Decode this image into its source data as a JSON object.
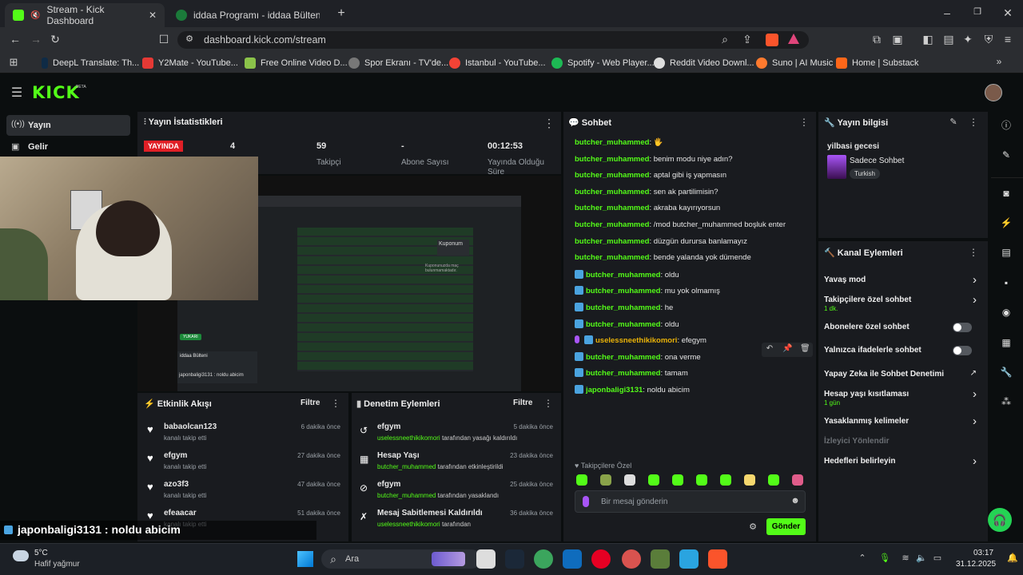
{
  "browser": {
    "tabs": [
      {
        "title": "Stream - Kick Dashboard",
        "active": true
      },
      {
        "title": "iddaa Programı - iddaa Bülteni | iddaa"
      }
    ],
    "url": "dashboard.kick.com/stream",
    "bookmarks": [
      "DeepL Translate: Th...",
      "Y2Mate - YouTube...",
      "Free Online Video D...",
      "Spor Ekranı - TV'de...",
      "Istanbul - YouTube...",
      "Spotify - Web Player...",
      "Reddit Video Downl...",
      "Suno | AI Music",
      "Home | Substack"
    ]
  },
  "kick": {
    "logo": "KICK",
    "logo_beta": "BETA",
    "nav": [
      {
        "label": "Yayın",
        "active": true
      },
      {
        "label": "Gelir"
      }
    ]
  },
  "stats": {
    "title": "Yayın İstatistikleri",
    "live_badge": "YAYINDA",
    "items": [
      {
        "value": "4",
        "label": ""
      },
      {
        "value": "59",
        "label": "Takipçi"
      },
      {
        "value": "-",
        "label": "Abone Sayısı"
      },
      {
        "value": "00:12:53",
        "label": "Yayında Olduğu Süre"
      }
    ]
  },
  "preview": {
    "overlay_left": "YUKARI",
    "overlay_chat": "japonbaligi3131 : noldu abicim",
    "coupon_title": "Kuponum",
    "coupon_empty": "Kuponunuzda maç bulunmamaktadır.",
    "bulletin": "iddaa Bülteni"
  },
  "activity": {
    "title": "Etkinlik Akışı",
    "filter": "Filtre",
    "items": [
      {
        "user": "babaolcan123",
        "action": "kanalı takip etti",
        "time": "6 dakika önce"
      },
      {
        "user": "efgym",
        "action": "kanalı takip etti",
        "time": "27 dakika önce"
      },
      {
        "user": "azo3f3",
        "action": "kanalı takip etti",
        "time": "47 dakika önce"
      },
      {
        "user": "efeaacar",
        "action": "kanalı takip etti",
        "time": "51 dakika önce"
      }
    ]
  },
  "moderation": {
    "title": "Denetim Eylemleri",
    "filter": "Filtre",
    "items": [
      {
        "title": "efgym",
        "actor": "uselessneethikikomori",
        "desc": "tarafından yasağı kaldırıldı",
        "time": "5 dakika önce",
        "icon": "undo-icon"
      },
      {
        "title": "Hesap Yaşı",
        "actor": "butcher_muhammed",
        "desc": "tarafından etkinleştirildi",
        "time": "23 dakika önce",
        "icon": "calendar-icon"
      },
      {
        "title": "efgym",
        "actor": "butcher_muhammed",
        "desc": "tarafından yasaklandı",
        "time": "25 dakika önce",
        "icon": "ban-icon"
      },
      {
        "title": "Mesaj Sabitlemesi Kaldırıldı",
        "actor": "uselessneethikikomori",
        "desc": "tarafından",
        "time": "36 dakika önce",
        "icon": "unpin-icon"
      }
    ]
  },
  "chat": {
    "title": "Sohbet",
    "messages": [
      {
        "user": "butcher_muhammed",
        "text": "🖐",
        "badge": false
      },
      {
        "user": "butcher_muhammed",
        "text": "benim modu niye adın?",
        "badge": false
      },
      {
        "user": "butcher_muhammed",
        "text": "aptal gibi iş yapmasın",
        "badge": false
      },
      {
        "user": "butcher_muhammed",
        "text": "sen ak partilimisin?",
        "badge": false
      },
      {
        "user": "butcher_muhammed",
        "text": "akraba kayırıyorsun",
        "badge": false
      },
      {
        "user": "butcher_muhammed",
        "text": "/mod butcher_muhammed boşluk enter",
        "badge": false
      },
      {
        "user": "butcher_muhammed",
        "text": "düzgün durursa banlamayız",
        "badge": false
      },
      {
        "user": "butcher_muhammed",
        "text": "bende yalanda yok dümende",
        "badge": false
      },
      {
        "user": "butcher_muhammed",
        "text": "oldu",
        "badge": true
      },
      {
        "user": "butcher_muhammed",
        "text": "mu yok olmamış",
        "badge": true
      },
      {
        "user": "butcher_muhammed",
        "text": "he",
        "badge": true
      },
      {
        "user": "butcher_muhammed",
        "text": "oldu",
        "badge": true
      },
      {
        "user": "uselessneethikikomori",
        "text": "efegym",
        "badge": true,
        "special": true
      },
      {
        "user": "butcher_muhammed",
        "text": "ona verme",
        "badge": true
      },
      {
        "user": "butcher_muhammed",
        "text": "tamam",
        "badge": true
      },
      {
        "user": "japonbaligi3131",
        "text": "noldu abicim",
        "badge": true
      }
    ],
    "followers_only": "Takipçilere Özel",
    "input_placeholder": "Bir mesaj gönderin",
    "send": "Gönder"
  },
  "stream_info": {
    "title": "Yayın bilgisi",
    "stream_title": "yilbasi gecesi",
    "category": "Sadece Sohbet",
    "tag": "Turkish"
  },
  "channel_actions": {
    "title": "Kanal Eylemleri",
    "items": [
      {
        "label": "Yavaş mod",
        "type": "chevron"
      },
      {
        "label": "Takipçilere özel sohbet",
        "sub": "1 dk.",
        "type": "chevron"
      },
      {
        "label": "Abonelere özel sohbet",
        "type": "toggle"
      },
      {
        "label": "Yalnızca ifadelerle sohbet",
        "type": "toggle"
      },
      {
        "label": "Yapay Zeka ile Sohbet Denetimi",
        "type": "external"
      },
      {
        "label": "Hesap yaşı kısıtlaması",
        "sub": "1 gün",
        "type": "chevron"
      },
      {
        "label": "Yasaklanmış kelimeler",
        "type": "chevron"
      },
      {
        "label": "İzleyici Yönlendir",
        "type": "disabled"
      },
      {
        "label": "Hedefleri belirleyin",
        "type": "chevron"
      }
    ]
  },
  "overlay": {
    "caption": "japonbaligi3131 : noldu abicim"
  },
  "taskbar": {
    "weather_temp": "5°C",
    "weather_desc": "Hafif yağmur",
    "search": "Ara",
    "time": "03:17",
    "date": "31.12.2025"
  }
}
